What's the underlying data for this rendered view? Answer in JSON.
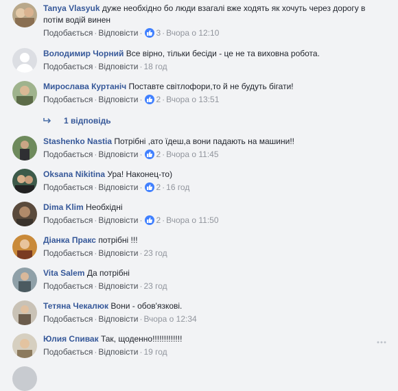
{
  "labels": {
    "like": "Подобається",
    "reply": "Відповісти",
    "sep": "·"
  },
  "comments": [
    {
      "author": "Tanya Vlasyuk",
      "text": "дуже необхідно бо люди взагалі вже ходять як хочуть через дорогу в потім водій винен",
      "likes": "3",
      "time": "Вчора о 12:10"
    },
    {
      "author": "Володимир Чорний",
      "text": "Все вірно, тільки бесіди - це не та виховна робота.",
      "likes": "",
      "time": "18 год"
    },
    {
      "author": "Мирослава Куртаніч",
      "text": "Поставте світлофори,то й не будуть бігати!",
      "likes": "2",
      "time": "Вчора о 13:51"
    },
    {
      "author": "Stashenko Nastia",
      "text": "Потрібні ,ато їдеш,а вони падають на машини!!",
      "likes": "2",
      "time": "Вчора о 11:45"
    },
    {
      "author": "Oksana Nikitina",
      "text": "Ура! Наконец-то)",
      "likes": "2",
      "time": "16 год"
    },
    {
      "author": "Dima Klim",
      "text": "Необхідні",
      "likes": "2",
      "time": "Вчора о 11:50"
    },
    {
      "author": "Діанка Пракс",
      "text": "потрібні !!!",
      "likes": "",
      "time": "23 год"
    },
    {
      "author": "Vita Salem",
      "text": "Да потрібні",
      "likes": "",
      "time": "23 год"
    },
    {
      "author": "Тетяна Чекалюк",
      "text": "Вони - обов'язкові.",
      "likes": "",
      "time": "Вчора о 12:34"
    },
    {
      "author": "Юлия Спивак",
      "text": "Так, щоденно!!!!!!!!!!!!!",
      "likes": "",
      "time": "19 год"
    }
  ],
  "replies_link": "1 відповідь",
  "colors": {
    "author": "#365899",
    "like_badge": "#4080ff",
    "background": "#f2f3f5"
  }
}
